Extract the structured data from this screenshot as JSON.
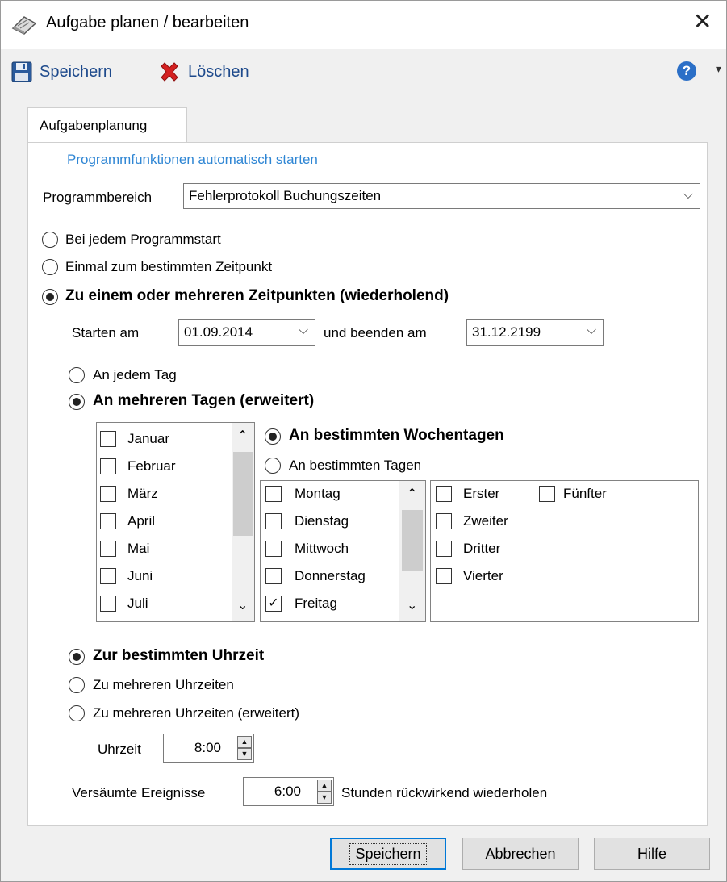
{
  "window": {
    "title": "Aufgabe planen / bearbeiten",
    "close_glyph": "✕"
  },
  "toolbar": {
    "save_label": "Speichern",
    "delete_label": "Löschen",
    "help_glyph": "?",
    "dropdown_glyph": "▾"
  },
  "tab": {
    "label": "Aufgabenplanung"
  },
  "group": {
    "title": "Programmfunktionen automatisch starten"
  },
  "programmbereich": {
    "label": "Programmbereich",
    "value": "Fehlerprotokoll Buchungszeiten"
  },
  "start_mode": {
    "options": [
      "Bei jedem Programmstart",
      "Einmal zum bestimmten Zeitpunkt",
      "Zu einem oder mehreren Zeitpunkten (wiederholend)"
    ],
    "selected_index": 2
  },
  "date_range": {
    "start_label": "Starten am",
    "start_value": "01.09.2014",
    "end_label": "und beenden am",
    "end_value": "31.12.2199"
  },
  "day_mode": {
    "options": [
      "An jedem Tag",
      "An mehreren Tagen (erweitert)"
    ],
    "selected_index": 1
  },
  "months": {
    "items": [
      {
        "label": "Januar",
        "checked": false
      },
      {
        "label": "Februar",
        "checked": false
      },
      {
        "label": "März",
        "checked": false
      },
      {
        "label": "April",
        "checked": false
      },
      {
        "label": "Mai",
        "checked": false
      },
      {
        "label": "Juni",
        "checked": false
      },
      {
        "label": "Juli",
        "checked": false
      }
    ]
  },
  "weekday_mode": {
    "options": [
      "An bestimmten Wochentagen",
      "An bestimmten Tagen"
    ],
    "selected_index": 0
  },
  "weekdays": {
    "items": [
      {
        "label": "Montag",
        "checked": false
      },
      {
        "label": "Dienstag",
        "checked": false
      },
      {
        "label": "Mittwoch",
        "checked": false
      },
      {
        "label": "Donnerstag",
        "checked": false
      },
      {
        "label": "Freitag",
        "checked": true
      }
    ]
  },
  "occurrences": {
    "items": [
      {
        "label": "Erster",
        "checked": false
      },
      {
        "label": "Zweiter",
        "checked": false
      },
      {
        "label": "Dritter",
        "checked": false
      },
      {
        "label": "Vierter",
        "checked": false
      },
      {
        "label": "Fünfter",
        "checked": false
      }
    ]
  },
  "time_mode": {
    "options": [
      "Zur bestimmten Uhrzeit",
      "Zu mehreren Uhrzeiten",
      "Zu mehreren Uhrzeiten (erweitert)"
    ],
    "selected_index": 0
  },
  "uhrzeit": {
    "label": "Uhrzeit",
    "value": "8:00"
  },
  "missed": {
    "label": "Versäumte Ereignisse",
    "value": "6:00",
    "suffix": "Stunden rückwirkend wiederholen"
  },
  "buttons": {
    "save": "Speichern",
    "cancel": "Abbrechen",
    "help": "Hilfe"
  },
  "glyphs": {
    "chevron_down": "⌵",
    "scroll_up": "⌃",
    "scroll_down": "⌄",
    "check": "✓",
    "spin_up": "▲",
    "spin_down": "▼"
  },
  "colors": {
    "accent": "#2f86d4",
    "toolbar_text": "#1e4a8c",
    "delete_red": "#d42020",
    "default_button_border": "#0078d7"
  }
}
